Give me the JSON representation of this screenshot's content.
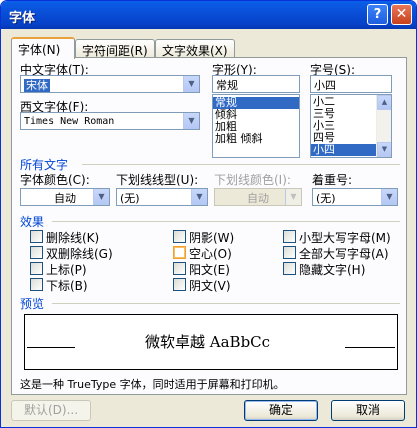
{
  "window": {
    "title": "字体",
    "help": "?",
    "close": "✕"
  },
  "tabs": [
    "字体(N)",
    "字符间距(R)",
    "文字效果(X)"
  ],
  "cn_font": {
    "label": "中文字体(T):",
    "value": "宋体"
  },
  "style": {
    "label": "字形(Y):",
    "value": "常规",
    "items": [
      "常规",
      "倾斜",
      "加粗",
      "加粗 倾斜"
    ],
    "selected": 0
  },
  "size": {
    "label": "字号(S):",
    "value": "小四",
    "items": [
      "小二",
      "三号",
      "小三",
      "四号",
      "小四"
    ],
    "selected": 4
  },
  "en_font": {
    "label": "西文字体(F):",
    "value": "Times New Roman"
  },
  "all_text": {
    "heading": "所有文字",
    "color_label": "字体颜色(C):",
    "color_value": "自动",
    "underline_label": "下划线线型(U):",
    "underline_value": "(无)",
    "ucolor_label": "下划线颜色(I):",
    "ucolor_value": "自动",
    "emphasis_label": "着重号:",
    "emphasis_value": "(无)"
  },
  "effects": {
    "heading": "效果",
    "items": [
      "删除线(K)",
      "双删除线(G)",
      "上标(P)",
      "下标(B)",
      "阴影(W)",
      "空心(O)",
      "阳文(E)",
      "阴文(V)",
      "小型大写字母(M)",
      "全部大写字母(A)",
      "隐藏文字(H)"
    ]
  },
  "preview": {
    "heading": "预览",
    "text": "微软卓越  AaBbCc"
  },
  "note": "这是一种 TrueType 字体，同时适用于屏幕和打印机。",
  "buttons": {
    "default": "默认(D)...",
    "ok": "确定",
    "cancel": "取消"
  }
}
